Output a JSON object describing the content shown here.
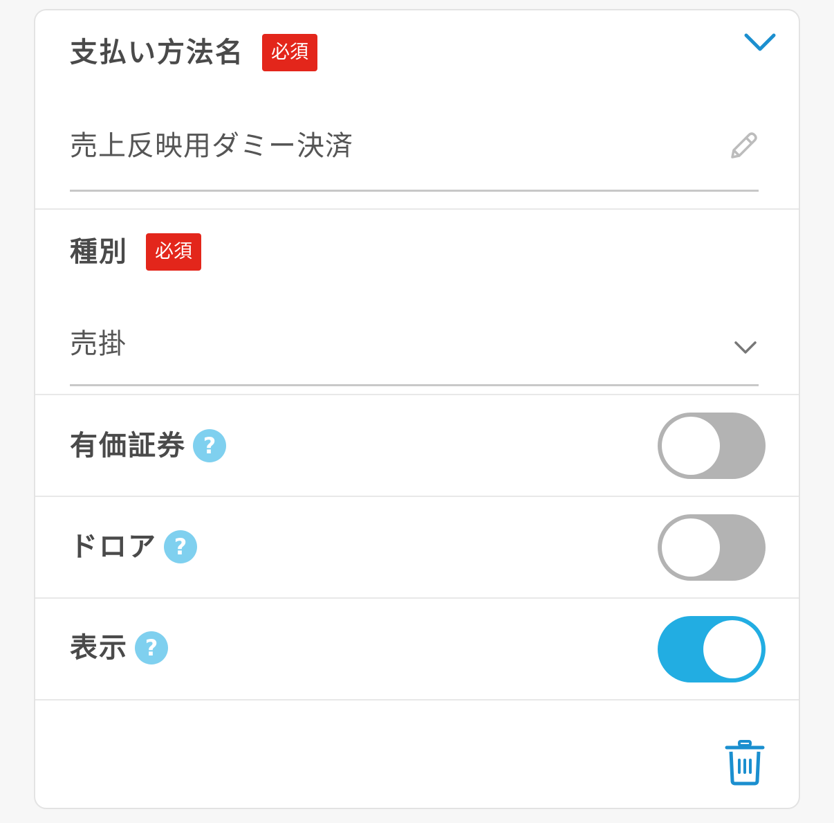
{
  "payment_name": {
    "label": "支払い方法名",
    "required_badge": "必須",
    "value": "売上反映用ダミー決済"
  },
  "type": {
    "label": "種別",
    "required_badge": "必須",
    "value": "売掛"
  },
  "toggles": [
    {
      "label": "有価証券",
      "help": "?",
      "state": "off"
    },
    {
      "label": "ドロア",
      "help": "?",
      "state": "off"
    },
    {
      "label": "表示",
      "help": "?",
      "state": "on"
    }
  ],
  "icons": {
    "collapse": "chevron-down-icon",
    "edit": "pencil-icon",
    "type_dropdown": "chevron-down-icon",
    "delete": "trash-icon"
  },
  "colors": {
    "required": "#e3261b",
    "accent": "#22ade2",
    "help": "#7fd0ef",
    "toggle_off": "#b3b3b3"
  }
}
